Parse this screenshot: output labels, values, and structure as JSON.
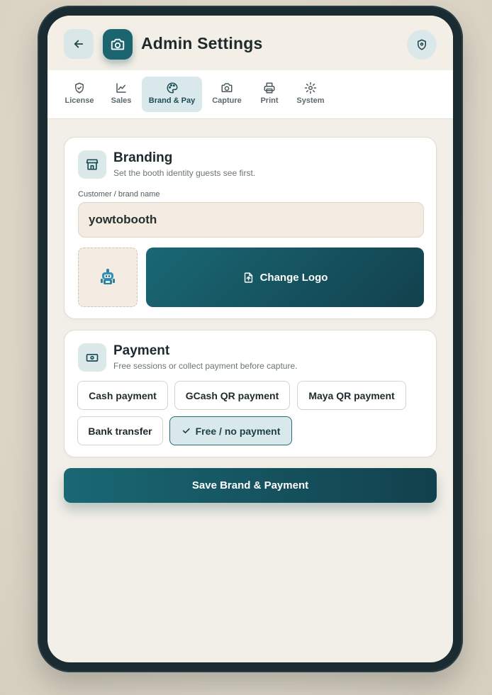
{
  "header": {
    "title": "Admin Settings",
    "back_icon": "arrow-left-icon",
    "badge_icon": "camera-icon",
    "right_icon": "shield-pin-icon"
  },
  "tabs": [
    {
      "label": "License",
      "icon": "shield-check-icon",
      "active": false
    },
    {
      "label": "Sales",
      "icon": "line-chart-icon",
      "active": false
    },
    {
      "label": "Brand & Pay",
      "icon": "palette-icon",
      "active": true
    },
    {
      "label": "Capture",
      "icon": "camera-icon",
      "active": false
    },
    {
      "label": "Print",
      "icon": "printer-icon",
      "active": false
    },
    {
      "label": "System",
      "icon": "gear-icon",
      "active": false
    }
  ],
  "branding": {
    "title": "Branding",
    "subtitle": "Set the booth identity guests see first.",
    "field_label": "Customer / brand name",
    "brand_name": "yowtobooth",
    "change_logo_label": "Change Logo"
  },
  "payment": {
    "title": "Payment",
    "subtitle": "Free sessions or collect payment before capture.",
    "options": [
      {
        "label": "Cash payment",
        "selected": false
      },
      {
        "label": "GCash QR payment",
        "selected": false
      },
      {
        "label": "Maya QR payment",
        "selected": false
      },
      {
        "label": "Bank transfer",
        "selected": false
      },
      {
        "label": "Free / no payment",
        "selected": true
      }
    ]
  },
  "save_label": "Save Brand & Payment",
  "colors": {
    "accent": "#196874",
    "accent_dark": "#12414d",
    "tab_active_bg": "#d9e9eb",
    "input_bg": "#f4ece2"
  }
}
